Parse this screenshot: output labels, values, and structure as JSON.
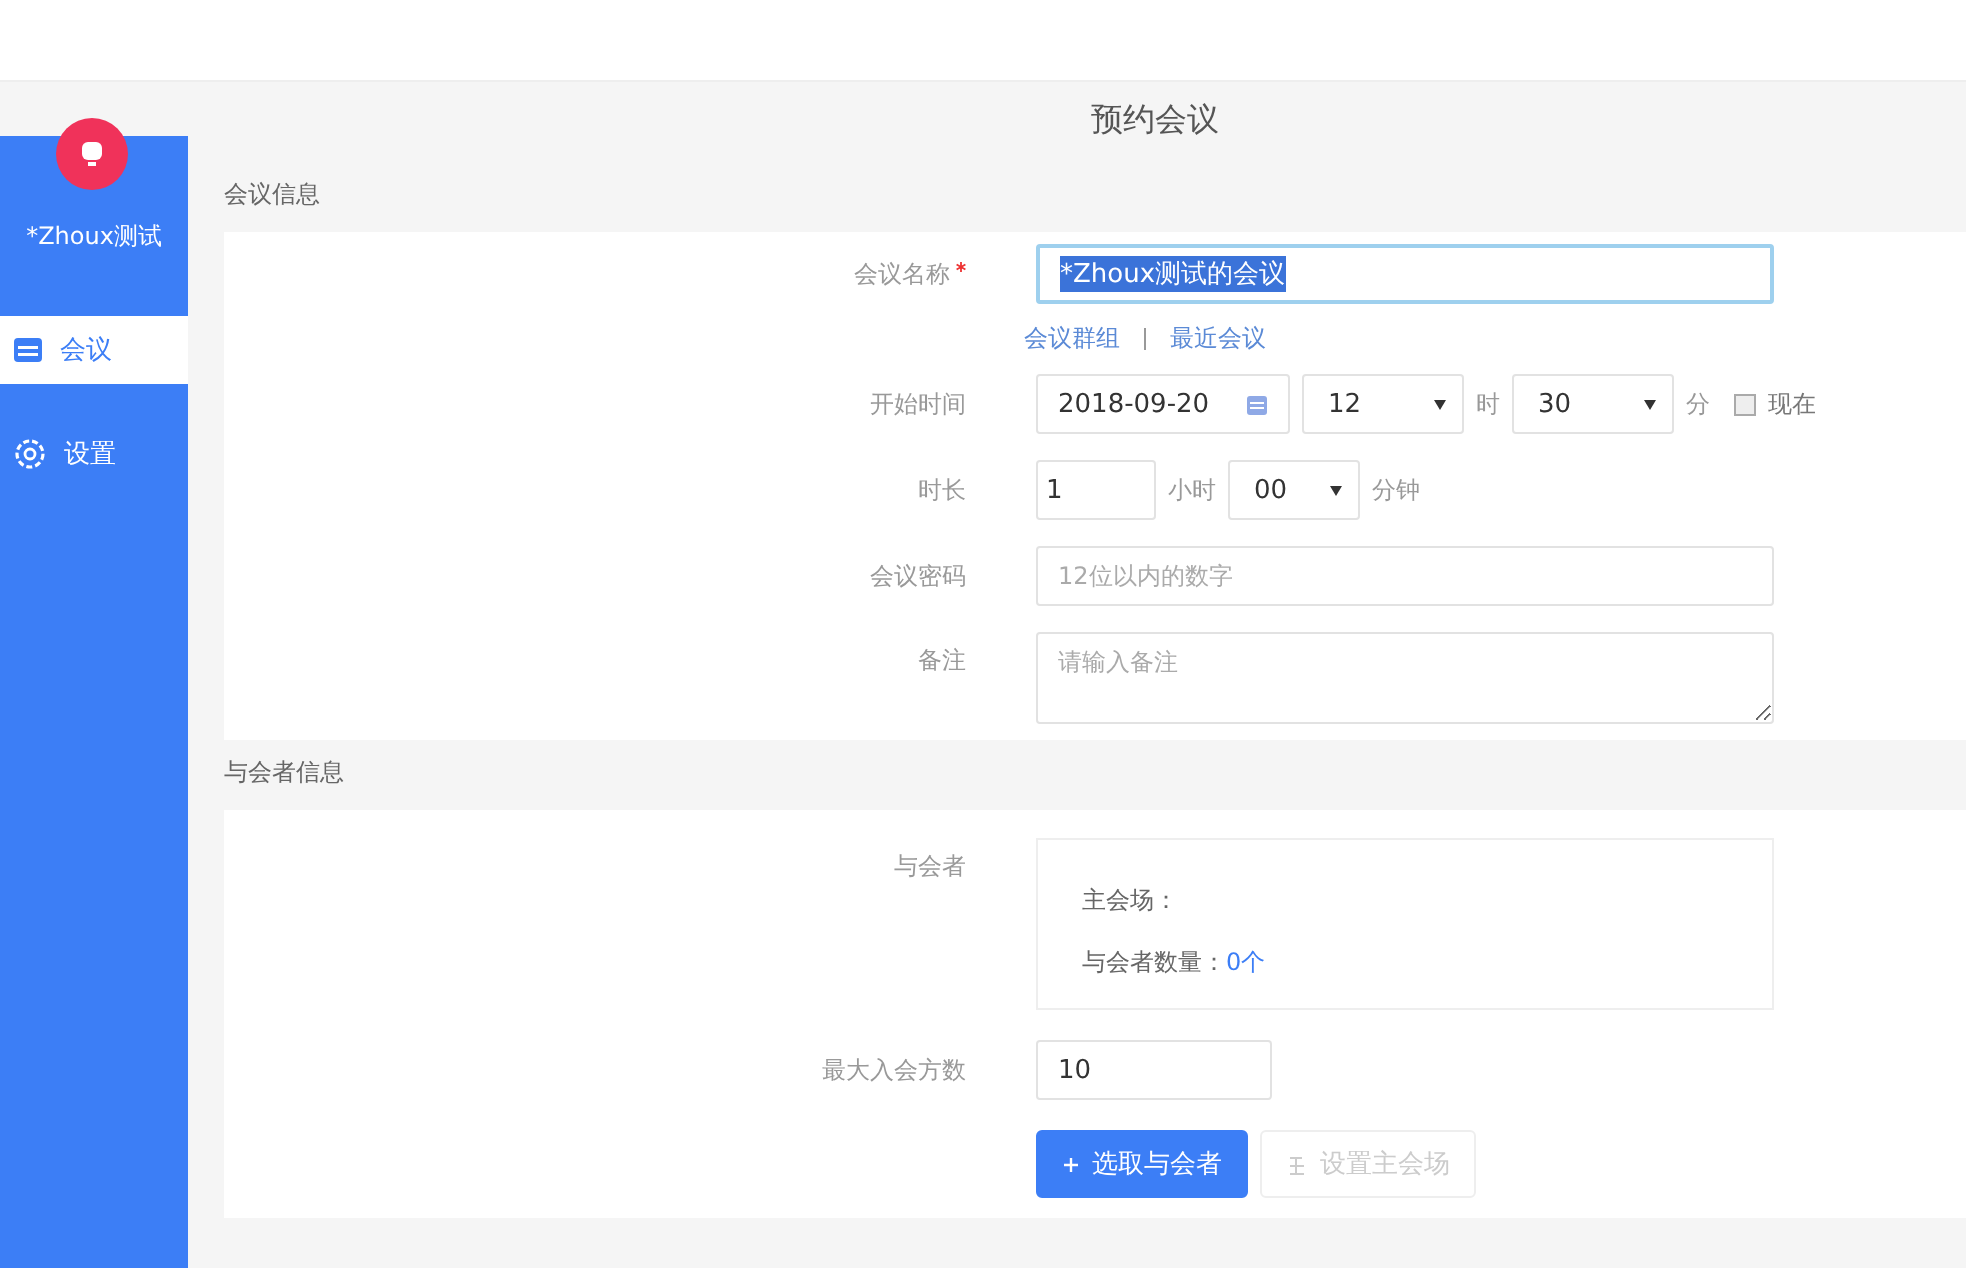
{
  "sidebar": {
    "user_name": "*Zhoux测试",
    "items": [
      {
        "kind": "calendar",
        "label": "会议",
        "selected": true
      },
      {
        "kind": "gear",
        "label": "设置",
        "selected": false
      }
    ]
  },
  "page_title": "预约会议",
  "meeting_info": {
    "heading": "会议信息",
    "name": {
      "label": "会议名称",
      "required": true,
      "value": "*Zhoux测试的会议",
      "text_selected": true
    },
    "links": [
      "会议群组",
      "最近会议"
    ],
    "start": {
      "label": "开始时间",
      "date": "2018-09-20",
      "hour": "12",
      "hour_unit": "时",
      "minute": "30",
      "minute_unit": "分",
      "now": {
        "label": "现在",
        "checked": false
      }
    },
    "duration": {
      "label": "时长",
      "hours": "1",
      "hours_unit": "小时",
      "minutes": "00",
      "minutes_unit": "分钟"
    },
    "password": {
      "label": "会议密码",
      "placeholder": "12位以内的数字"
    },
    "notes": {
      "label": "备注",
      "placeholder": "请输入备注"
    }
  },
  "participants": {
    "heading": "与会者信息",
    "list": {
      "label": "与会者",
      "main_venue_label": "主会场：",
      "count_label": "与会者数量：",
      "count": "0个"
    },
    "max": {
      "label": "最大入会方数",
      "value": "10"
    },
    "buttons": [
      {
        "kind": "primary",
        "label": "选取与会者",
        "disabled": false
      },
      {
        "kind": "secondary",
        "label": "设置主会场",
        "disabled": true
      }
    ]
  }
}
